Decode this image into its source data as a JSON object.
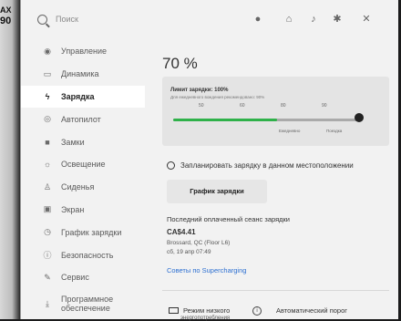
{
  "edge": {
    "top_text": "AX",
    "second_text": "90"
  },
  "search": {
    "placeholder": "Поиск"
  },
  "top_icons": [
    "person-icon",
    "home-icon",
    "bell-icon",
    "bluetooth-icon",
    "signal-off-icon"
  ],
  "sidebar": {
    "items": [
      {
        "label": "Управление",
        "icon": "car-top-icon",
        "active": false
      },
      {
        "label": "Динамика",
        "icon": "car-icon",
        "active": false
      },
      {
        "label": "Зарядка",
        "icon": "lightning-icon",
        "active": true
      },
      {
        "label": "Автопилот",
        "icon": "steering-wheel-icon",
        "active": false
      },
      {
        "label": "Замки",
        "icon": "lock-icon",
        "active": false
      },
      {
        "label": "Освещение",
        "icon": "sun-icon",
        "active": false
      },
      {
        "label": "Сиденья",
        "icon": "seat-icon",
        "active": false
      },
      {
        "label": "Экран",
        "icon": "screen-icon",
        "active": false
      },
      {
        "label": "График зарядки",
        "icon": "clock-icon",
        "active": false
      },
      {
        "label": "Безопасность",
        "icon": "shield-icon",
        "active": false
      },
      {
        "label": "Сервис",
        "icon": "wrench-icon",
        "active": false
      },
      {
        "label": "Программное обеспечение",
        "icon": "download-icon",
        "active": false
      }
    ]
  },
  "main": {
    "battery_percent": "70 %",
    "limit_title": "Лимит зарядки: 100%",
    "limit_subtitle": "Для ежедневного вождения рекомендовано: 90%",
    "tick_labels": [
      "50",
      "60",
      "80",
      "90"
    ],
    "limit_level": 1.0,
    "zone_daily": "Ежедневно",
    "zone_trip": "Поездка",
    "schedule_label": "Запланировать зарядку в данном местоположении",
    "schedule_button": "График зарядки",
    "last_session_title": "Последний оплаченный сеанс зарядки",
    "last_session_price": "CA$4.41",
    "last_session_location": "Brossard, QC (Floor L6)",
    "last_session_date": "сб, 19 апр 07:49",
    "supercharging_tips": "Советы по Supercharging",
    "low_mode_label": "Режим низкого",
    "low_mode_sub": "энергопотребления",
    "auto_threshold_label": "Автоматический порог"
  }
}
